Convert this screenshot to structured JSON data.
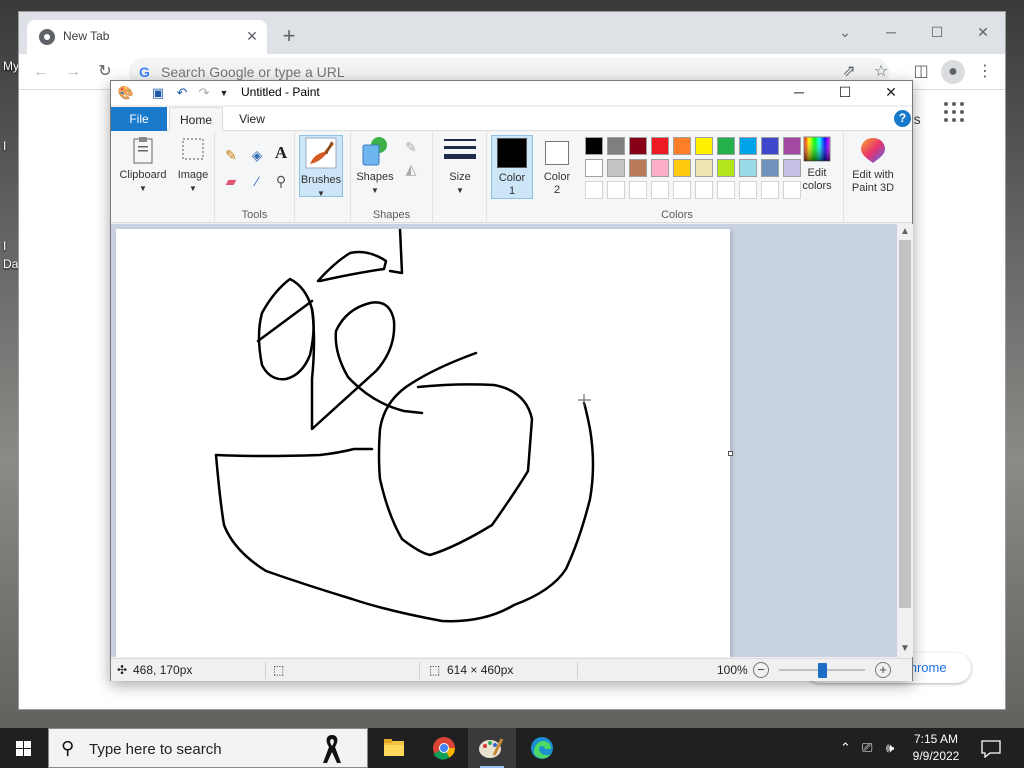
{
  "desktop": {
    "icon_labels": [
      "My",
      "I",
      "I",
      "Da"
    ]
  },
  "chrome": {
    "tab_title": "New Tab",
    "omnibox_placeholder": "Search Google or type a URL",
    "new_tab_text_fragment": "ges",
    "customize_button": "ze Chrome",
    "icons": [
      "back-icon",
      "forward-icon",
      "reload-icon",
      "share-icon",
      "star-icon",
      "sidepanel-icon",
      "profile-icon",
      "menu-icon",
      "apps-grid-icon"
    ]
  },
  "paint": {
    "window_title": "Untitled - Paint",
    "menu": {
      "file": "File",
      "home": "Home",
      "view": "View"
    },
    "ribbon": {
      "clipboard": "Clipboard",
      "image": "Image",
      "tools_group": "Tools",
      "brushes": "Brushes",
      "shapes": "Shapes",
      "shapes_group": "Shapes",
      "size": "Size",
      "color1": "Color",
      "color1_num": "1",
      "color2": "Color",
      "color2_num": "2",
      "colors_group": "Colors",
      "edit_colors_1": "Edit",
      "edit_colors_2": "colors",
      "edit_3d_1": "Edit with",
      "edit_3d_2": "Paint 3D"
    },
    "palette_row1": [
      "#000000",
      "#7f7f7f",
      "#880015",
      "#ed1c24",
      "#ff7f27",
      "#fff200",
      "#22b14c",
      "#00a2e8",
      "#3f48cc",
      "#a349a4"
    ],
    "palette_row2": [
      "#ffffff",
      "#c3c3c3",
      "#b97a57",
      "#ffaec9",
      "#ffc90e",
      "#efe4b0",
      "#b5e61d",
      "#99d9ea",
      "#7092be",
      "#c8bfe7"
    ],
    "color1_value": "#000000",
    "color2_value": "#ffffff",
    "status": {
      "cursor_pos": "468, 170px",
      "canvas_size": "614 × 460px",
      "zoom": "100%"
    }
  },
  "taskbar": {
    "search_placeholder": "Type here to search",
    "time": "7:15 AM",
    "date": "9/9/2022",
    "apps": [
      "file-explorer",
      "chrome",
      "paint",
      "edge"
    ]
  }
}
